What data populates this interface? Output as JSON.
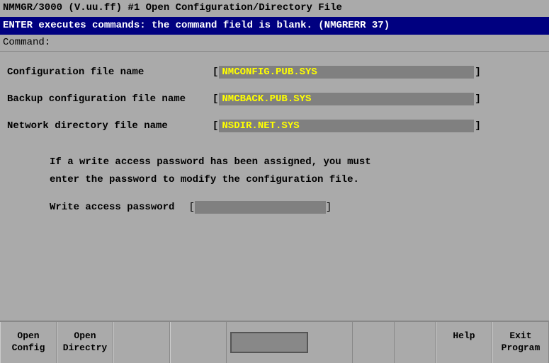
{
  "title_bar": {
    "text": "NMMGR/3000 (V.uu.ff) #1  Open Configuration/Directory File"
  },
  "status_bar": {
    "text": "ENTER executes commands:  the command field is blank. (NMGRERR 37)"
  },
  "command_bar": {
    "label": "Command:",
    "value": ""
  },
  "form": {
    "fields": [
      {
        "label": "Configuration file name",
        "value": "NMCONFIG.PUB.SYS",
        "name": "config-file-name"
      },
      {
        "label": "Backup configuration file name",
        "value": "NMCBACK.PUB.SYS",
        "name": "backup-config-file-name"
      },
      {
        "label": "Network directory file name",
        "value": "NSDIR.NET.SYS",
        "name": "network-dir-file-name"
      }
    ],
    "info_text_line1": "If a write access password has been assigned, you must",
    "info_text_line2": "enter the password to modify the configuration file.",
    "password_label": "Write access password",
    "password_value": ""
  },
  "function_keys": [
    {
      "line1": "Open",
      "line2": "Config",
      "name": "open-config"
    },
    {
      "line1": "Open",
      "line2": "Directry",
      "name": "open-directory"
    },
    {
      "line1": "",
      "line2": "",
      "name": "f3-blank"
    },
    {
      "line1": "",
      "line2": "",
      "name": "f4-blank"
    },
    {
      "line1": "",
      "line2": "",
      "name": "f5-blank"
    },
    {
      "line1": "",
      "line2": "",
      "name": "f6-blank"
    },
    {
      "line1": "",
      "line2": "",
      "name": "f7-blank"
    },
    {
      "line1": "Help",
      "line2": "",
      "name": "help"
    },
    {
      "line1": "Exit",
      "line2": "Program",
      "name": "exit-program"
    }
  ]
}
